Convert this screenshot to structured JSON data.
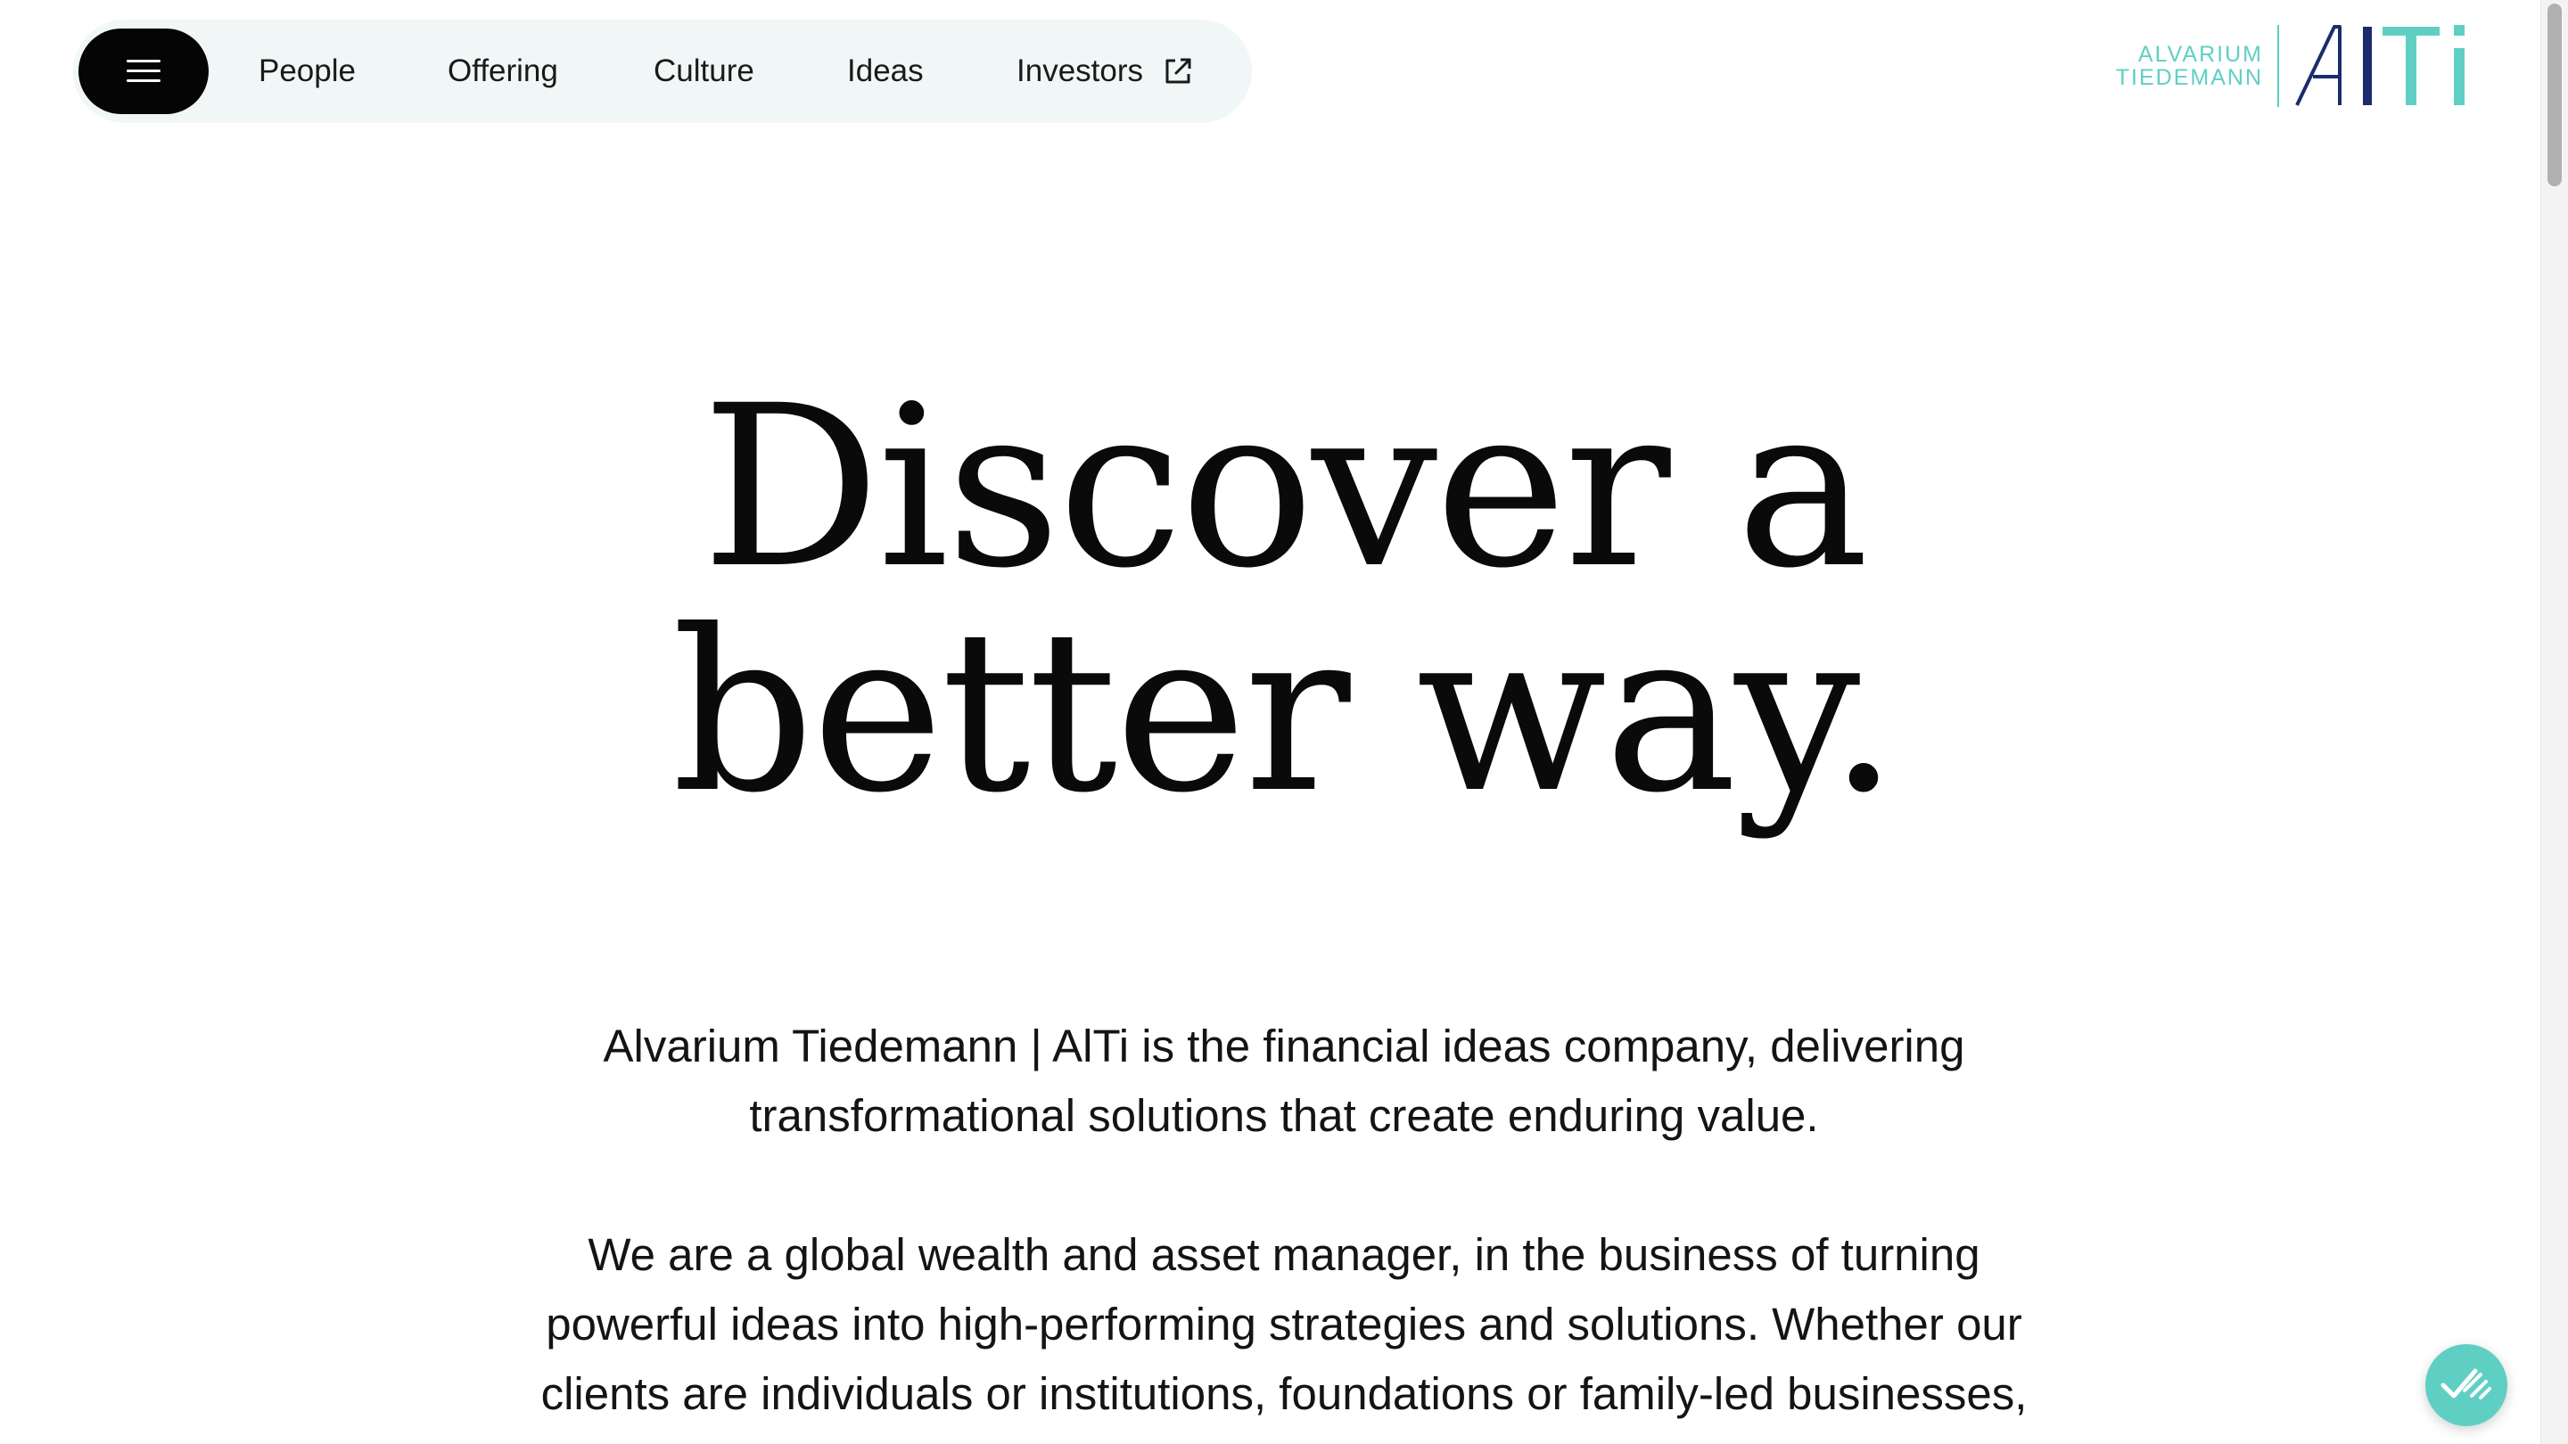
{
  "nav": {
    "menu_label": "Menu",
    "links": [
      {
        "label": "People"
      },
      {
        "label": "Offering"
      },
      {
        "label": "Culture"
      },
      {
        "label": "Ideas"
      },
      {
        "label": "Investors",
        "icon": "external-link-icon"
      }
    ]
  },
  "logo": {
    "line1": "ALVARIUM",
    "line2": "TIEDEMANN",
    "mark": "AlTi",
    "colors": {
      "teal": "#5fcfc4",
      "navy": "#1c2b6b"
    }
  },
  "hero": {
    "line1": "Discover a",
    "line2": "better way."
  },
  "intro": {
    "paragraph1": "Alvarium Tiedemann | AlTi is the financial ideas company, delivering transformational solutions that create enduring value.",
    "paragraph2": "We are a global wealth and asset manager, in the business of turning powerful ideas into high-performing strategies and solutions. Whether our clients are individuals or institutions, foundations or family-led businesses, we offer a connected ecosystem of advice,"
  },
  "chat": {
    "icon": "chat-widget-icon",
    "color": "#5fcfc4"
  },
  "colors": {
    "nav_bg": "#f0f7f6",
    "menu_button_bg": "#050505",
    "accent": "#5fcfc4"
  }
}
